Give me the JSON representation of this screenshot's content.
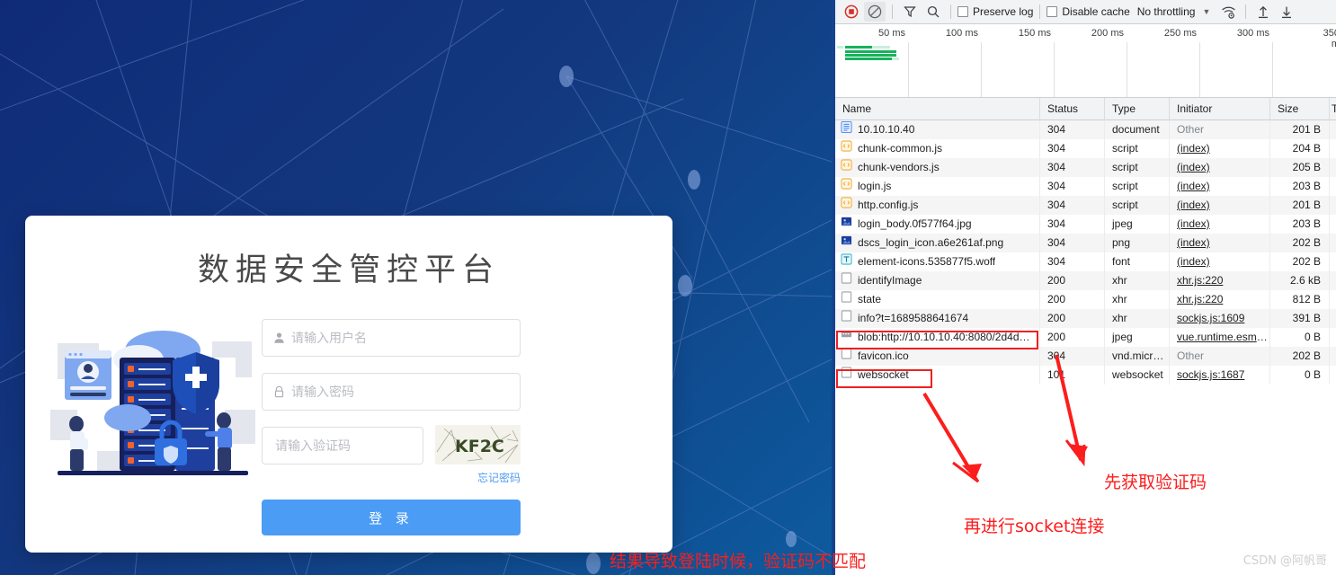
{
  "login": {
    "title": "数据安全管控平台",
    "username": {
      "placeholder": "请输入用户名",
      "value": "",
      "icon": "user-icon"
    },
    "password": {
      "placeholder": "请输入密码",
      "value": "",
      "icon": "lock-icon"
    },
    "captcha": {
      "placeholder": "请输入验证码",
      "value": "",
      "image_text": "KF2C"
    },
    "forgot_label": "忘记密码",
    "submit_label": "登 录",
    "accent_color": "#4b9cf5",
    "background_color": "#12307f",
    "card_color": "#ffffff"
  },
  "devtools": {
    "toolbar": {
      "record_icon": "record-stop-icon",
      "clear_icon": "clear-icon",
      "filter_icon": "filter-icon",
      "search_icon": "search-icon",
      "preserve_log_label": "Preserve log",
      "preserve_log_checked": false,
      "disable_cache_label": "Disable cache",
      "disable_cache_checked": false,
      "throttling_label": "No throttling",
      "throttling_caret": "▼",
      "wifi_icon": "network-conditions-icon",
      "import_icon": "import-har-icon",
      "export_icon": "export-har-icon",
      "record_color": "#d93025"
    },
    "overview": {
      "ticks": [
        "50 ms",
        "100 ms",
        "150 ms",
        "200 ms",
        "250 ms",
        "300 ms",
        "350 m"
      ],
      "bar_color": "#17b25c"
    },
    "columns": [
      "Name",
      "Status",
      "Type",
      "Initiator",
      "Size",
      "T"
    ],
    "rows": [
      {
        "name": "10.10.10.40",
        "icon": "document-icon",
        "status": "304",
        "type": "document",
        "initiator": "Other",
        "initiator_link": false,
        "size": "201 B"
      },
      {
        "name": "chunk-common.js",
        "icon": "script-icon",
        "status": "304",
        "type": "script",
        "initiator": "(index)",
        "initiator_link": true,
        "size": "204 B"
      },
      {
        "name": "chunk-vendors.js",
        "icon": "script-icon",
        "status": "304",
        "type": "script",
        "initiator": "(index)",
        "initiator_link": true,
        "size": "205 B"
      },
      {
        "name": "login.js",
        "icon": "script-icon",
        "status": "304",
        "type": "script",
        "initiator": "(index)",
        "initiator_link": true,
        "size": "203 B"
      },
      {
        "name": "http.config.js",
        "icon": "script-icon",
        "status": "304",
        "type": "script",
        "initiator": "(index)",
        "initiator_link": true,
        "size": "201 B"
      },
      {
        "name": "login_body.0f577f64.jpg",
        "icon": "image-icon",
        "status": "304",
        "type": "jpeg",
        "initiator": "(index)",
        "initiator_link": true,
        "size": "203 B"
      },
      {
        "name": "dscs_login_icon.a6e261af.png",
        "icon": "image-icon",
        "status": "304",
        "type": "png",
        "initiator": "(index)",
        "initiator_link": true,
        "size": "202 B"
      },
      {
        "name": "element-icons.535877f5.woff",
        "icon": "font-icon",
        "status": "304",
        "type": "font",
        "initiator": "(index)",
        "initiator_link": true,
        "size": "202 B"
      },
      {
        "name": "identifyImage",
        "icon": "generic-icon",
        "status": "200",
        "type": "xhr",
        "initiator": "xhr.js:220",
        "initiator_link": true,
        "size": "2.6 kB"
      },
      {
        "name": "state",
        "icon": "generic-icon",
        "status": "200",
        "type": "xhr",
        "initiator": "xhr.js:220",
        "initiator_link": true,
        "size": "812 B"
      },
      {
        "name": "info?t=1689588641674",
        "icon": "generic-icon",
        "status": "200",
        "type": "xhr",
        "initiator": "sockjs.js:1609",
        "initiator_link": true,
        "size": "391 B"
      },
      {
        "name": "blob:http://10.10.10.40:8080/2d4d…",
        "icon": "blob-icon",
        "status": "200",
        "type": "jpeg",
        "initiator": "vue.runtime.esm.js…",
        "initiator_link": true,
        "size": "0 B"
      },
      {
        "name": "favicon.ico",
        "icon": "generic-icon",
        "status": "304",
        "type": "vnd.micro…",
        "initiator": "Other",
        "initiator_link": false,
        "size": "202 B"
      },
      {
        "name": "websocket",
        "icon": "generic-icon",
        "status": "101",
        "type": "websocket",
        "initiator": "sockjs.js:1687",
        "initiator_link": true,
        "size": "0 B"
      }
    ]
  },
  "annotations": {
    "color": "#fc1d1d",
    "notes": [
      {
        "text": "先获取验证码"
      },
      {
        "text": "再进行socket连接"
      },
      {
        "text": "结果导致登陆时候，验证码不匹配"
      }
    ],
    "highlight_rows": [
      "blob:http://10.10.10.40:8080/2d4d…",
      "websocket"
    ]
  },
  "watermark": "CSDN @阿帆哥"
}
